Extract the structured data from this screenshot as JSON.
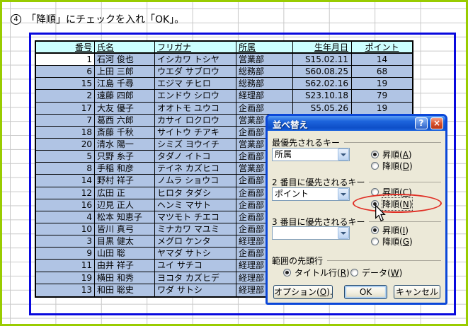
{
  "instruction": {
    "step": "4",
    "text": "「降順」にチェックを入れ「OK」。"
  },
  "colors": {
    "outer_border_green": "#99CC00",
    "print_area_border_blue": "#0909DE",
    "table_header_bg": "#CCFFFF",
    "selected_row_bg": "#B0C4E4",
    "active_cell_bg": "#FFFFFF",
    "dialog_face": "#ECE9D8",
    "dialog_titlebar_blue": "#1D64DC",
    "annotation_red": "#E02E24"
  },
  "table": {
    "headers": [
      "番号",
      "氏名",
      "フリガナ",
      "所属",
      "生年月日",
      "ポイント"
    ],
    "rows": [
      {
        "no": "1",
        "name": "石河 俊也",
        "kana": "イシカワ トシヤ",
        "dept": "営業部",
        "birth": "S15.02.11",
        "pts": "14"
      },
      {
        "no": "6",
        "name": "上田 三郎",
        "kana": "ウエダ サブロウ",
        "dept": "総務部",
        "birth": "S60.08.25",
        "pts": "68"
      },
      {
        "no": "15",
        "name": "江島 千尋",
        "kana": "エジマ チヒロ",
        "dept": "総務部",
        "birth": "S62.02.16",
        "pts": "19"
      },
      {
        "no": "2",
        "name": "遠藤 四郎",
        "kana": "エンドウ シロウ",
        "dept": "経理部",
        "birth": "S23.10.18",
        "pts": "79"
      },
      {
        "no": "17",
        "name": "大友 優子",
        "kana": "オオトモ ユウコ",
        "dept": "企画部",
        "birth": "S5.05.26",
        "pts": "19"
      },
      {
        "no": "7",
        "name": "葛西 六郎",
        "kana": "カサイ ロクロウ",
        "dept": "営業部",
        "birth": "",
        "pts": ""
      },
      {
        "no": "18",
        "name": "斎藤 千秋",
        "kana": "サイトウ チアキ",
        "dept": "企画部",
        "birth": "",
        "pts": ""
      },
      {
        "no": "20",
        "name": "清水 陽一",
        "kana": "シミズ ヨウイチ",
        "dept": "営業部",
        "birth": "",
        "pts": ""
      },
      {
        "no": "5",
        "name": "只野 糸子",
        "kana": "タダノ イトコ",
        "dept": "企画部",
        "birth": "",
        "pts": ""
      },
      {
        "no": "8",
        "name": "手稲 和彦",
        "kana": "テイネ カズヒコ",
        "dept": "営業部",
        "birth": "",
        "pts": ""
      },
      {
        "no": "14",
        "name": "野村 祥子",
        "kana": "ノムラ ショウコ",
        "dept": "企画部",
        "birth": "",
        "pts": ""
      },
      {
        "no": "12",
        "name": "広田 正",
        "kana": "ヒロタ タダシ",
        "dept": "企画部",
        "birth": "",
        "pts": ""
      },
      {
        "no": "16",
        "name": "辺見 正人",
        "kana": "ヘンミ マサト",
        "dept": "企画部",
        "birth": "",
        "pts": ""
      },
      {
        "no": "4",
        "name": "松本 知恵子",
        "kana": "マツモト チエコ",
        "dept": "企画部",
        "birth": "",
        "pts": ""
      },
      {
        "no": "10",
        "name": "皆川 真弓",
        "kana": "ミナカワ マユミ",
        "dept": "企画部",
        "birth": "",
        "pts": ""
      },
      {
        "no": "3",
        "name": "目黒 健太",
        "kana": "メグロ ケンタ",
        "dept": "経理部",
        "birth": "",
        "pts": ""
      },
      {
        "no": "9",
        "name": "山田 聡",
        "kana": "ヤマダ サトシ",
        "dept": "企画部",
        "birth": "",
        "pts": ""
      },
      {
        "no": "11",
        "name": "由井 祥子",
        "kana": "ユイ サチコ",
        "dept": "経理部",
        "birth": "",
        "pts": ""
      },
      {
        "no": "19",
        "name": "横田 和秀",
        "kana": "ヨコタ カズヒデ",
        "dept": "経理部",
        "birth": "",
        "pts": ""
      },
      {
        "no": "13",
        "name": "和田 聡史",
        "kana": "ワダ サトシ",
        "dept": "経理部",
        "birth": "",
        "pts": ""
      }
    ]
  },
  "dialog": {
    "title": "並べ替え",
    "help_glyph": "?",
    "close_glyph": "×",
    "sections": [
      {
        "label": "最優先されるキー",
        "combo_value": "所属",
        "radios": [
          {
            "pre": "昇順(",
            "key": "A",
            "post": ")",
            "selected": true
          },
          {
            "pre": "降順(",
            "key": "D",
            "post": ")",
            "selected": false
          }
        ]
      },
      {
        "label": "2 番目に優先されるキー",
        "combo_value": "ポイント",
        "radios": [
          {
            "pre": "昇順(",
            "key": "C",
            "post": ")",
            "selected": false
          },
          {
            "pre": "降順(",
            "key": "N",
            "post": ")",
            "selected": true,
            "focused": true,
            "circled": true
          }
        ]
      },
      {
        "label": "3 番目に優先されるキー",
        "combo_value": "",
        "radios": [
          {
            "pre": "昇順(",
            "key": "I",
            "post": ")",
            "selected": true
          },
          {
            "pre": "降順(",
            "key": "G",
            "post": ")",
            "selected": false
          }
        ]
      }
    ],
    "range_section": {
      "label": "範囲の先頭行",
      "radios": [
        {
          "pre": "タイトル行(",
          "key": "R",
          "post": ")",
          "selected": true
        },
        {
          "pre": "データ(",
          "key": "W",
          "post": ")",
          "selected": false
        }
      ]
    },
    "buttons": [
      {
        "pre": "オプション(",
        "key": "O",
        "post": ")..."
      },
      {
        "pre": "OK",
        "key": "",
        "post": ""
      },
      {
        "pre": "キャンセル",
        "key": "",
        "post": ""
      }
    ]
  }
}
